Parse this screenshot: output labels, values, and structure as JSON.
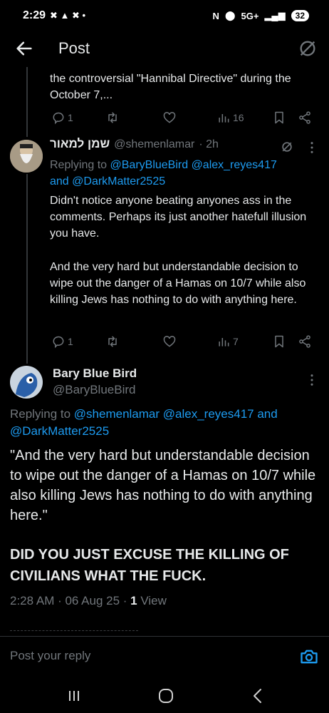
{
  "status": {
    "time": "2:29",
    "network": "5G+",
    "battery": "32"
  },
  "topbar": {
    "title": "Post"
  },
  "previous_tweet": {
    "text_tail": "the controversial \"Hannibal Directive\" during the October 7,...",
    "stats": {
      "replies": "1",
      "retweets": "",
      "likes": "",
      "views": "16"
    }
  },
  "reply1": {
    "name": "שמן למאור",
    "handle": "@shemenlamar",
    "time": "· 2h",
    "replying_label": "Replying to",
    "replying_to": "@BaryBlueBird @alex_reyes417",
    "replying_and": "and",
    "replying_to2": "@DarkMatter2525",
    "para1": "Didn't notice anyone beating anyones ass in the comments. Perhaps its just another hatefull illusion you have.",
    "para2": "And the very hard but understandable decision to wipe out the danger of a Hamas on 10/7 while also killing Jews has nothing to do with anything here.",
    "stats": {
      "replies": "1",
      "views": "7"
    }
  },
  "main_post": {
    "name": "Bary Blue Bird",
    "handle": "@BaryBlueBird",
    "replying_label": "Replying to",
    "replying_to": "@shemenlamar @alex_reyes417",
    "replying_and": "and",
    "replying_to2": "@DarkMatter2525",
    "quote": "\"And the very hard but understandable decision to wipe out the danger of a Hamas on 10/7 while also killing Jews has nothing to do with anything here.\"",
    "shout": "DID YOU JUST EXCUSE THE KILLING OF CIVILIANS WHAT THE FUCK.",
    "timestamp": "2:28 AM · 06 Aug 25 · ",
    "views_count": "1",
    "views_label": " View"
  },
  "reply_bar": {
    "placeholder": "Post your reply"
  },
  "colors": {
    "accent": "#1d9bf0",
    "muted": "#71767b",
    "text": "#e7e9ea",
    "background": "#000000"
  }
}
